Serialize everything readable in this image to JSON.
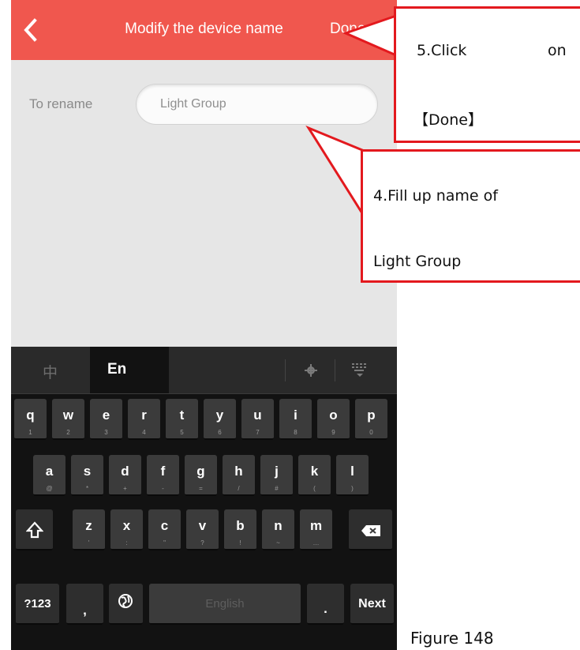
{
  "header": {
    "back_icon": "chevron-left-icon",
    "title": "Modify the device name",
    "done_label": "Done",
    "color": "#f0574e"
  },
  "form": {
    "label": "To rename",
    "value": "Light Group"
  },
  "keyboard": {
    "lang_cn": "中",
    "lang_en": "En",
    "settings_icon": "gear-icon",
    "hide_icon": "keyboard-hide-icon",
    "row1": [
      {
        "l": "q",
        "s": "1"
      },
      {
        "l": "w",
        "s": "2"
      },
      {
        "l": "e",
        "s": "3"
      },
      {
        "l": "r",
        "s": "4"
      },
      {
        "l": "t",
        "s": "5"
      },
      {
        "l": "y",
        "s": "6"
      },
      {
        "l": "u",
        "s": "7"
      },
      {
        "l": "i",
        "s": "8"
      },
      {
        "l": "o",
        "s": "9"
      },
      {
        "l": "p",
        "s": "0"
      }
    ],
    "row2": [
      {
        "l": "a",
        "s": "@"
      },
      {
        "l": "s",
        "s": "*"
      },
      {
        "l": "d",
        "s": "+"
      },
      {
        "l": "f",
        "s": "-"
      },
      {
        "l": "g",
        "s": "="
      },
      {
        "l": "h",
        "s": "/"
      },
      {
        "l": "j",
        "s": "#"
      },
      {
        "l": "k",
        "s": "("
      },
      {
        "l": "l",
        "s": ")"
      }
    ],
    "row3": [
      {
        "l": "z",
        "s": "'"
      },
      {
        "l": "x",
        "s": ":"
      },
      {
        "l": "c",
        "s": "\""
      },
      {
        "l": "v",
        "s": "?"
      },
      {
        "l": "b",
        "s": "!"
      },
      {
        "l": "n",
        "s": "~"
      },
      {
        "l": "m",
        "s": "…"
      }
    ],
    "shift_icon": "shift-icon",
    "backspace_icon": "backspace-icon",
    "symbols_label": "?123",
    "comma": ",",
    "globe_icon": "globe-icon",
    "space_label": "English",
    "period": ".",
    "next_label": "Next"
  },
  "callouts": {
    "done_line1": "5.Click",
    "done_line1b": "on",
    "done_line2": "【Done】",
    "name_line1": "4.Fill up name of",
    "name_line2": "Light Group"
  },
  "figure_caption": "Figure 148"
}
